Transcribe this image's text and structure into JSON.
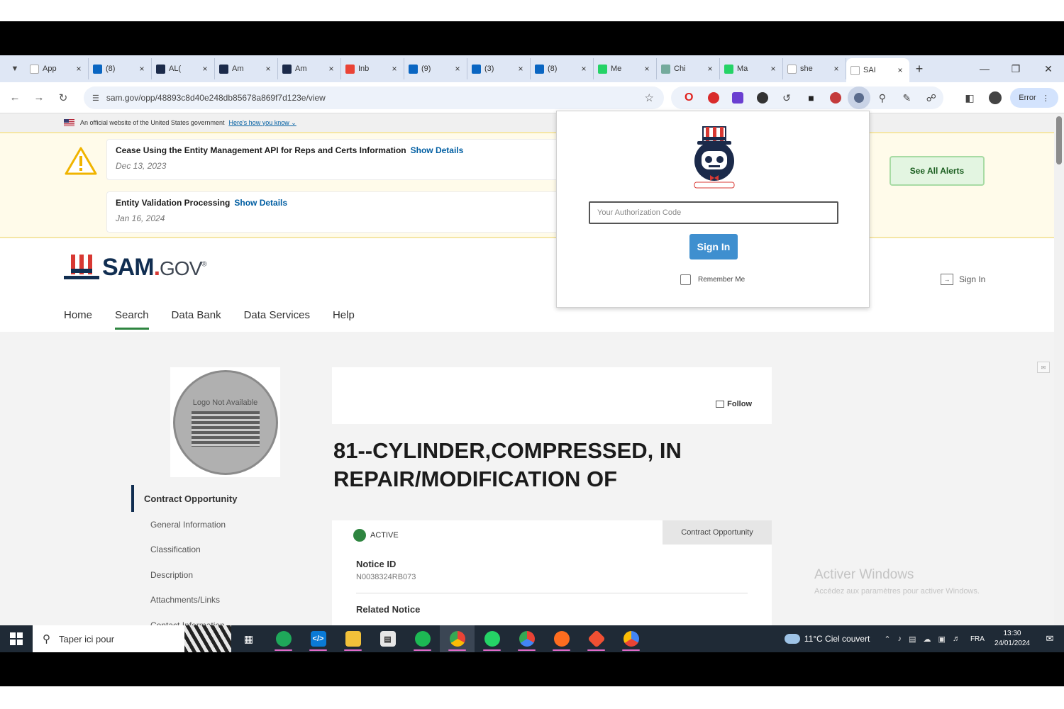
{
  "browser": {
    "tabs": [
      {
        "label": "App",
        "favicon": "doc",
        "color": "#ffffff"
      },
      {
        "label": "(8)",
        "favicon": "in",
        "color": "#0a66c2"
      },
      {
        "label": "AL(",
        "favicon": "dot",
        "color": "#1b2a4a"
      },
      {
        "label": "Am",
        "favicon": "dot",
        "color": "#1b2a4a"
      },
      {
        "label": "Am",
        "favicon": "dot",
        "color": "#1b2a4a"
      },
      {
        "label": "Inb",
        "favicon": "M",
        "color": "#ea4335"
      },
      {
        "label": "(9)",
        "favicon": "in",
        "color": "#0a66c2"
      },
      {
        "label": "(3)",
        "favicon": "in",
        "color": "#0a66c2"
      },
      {
        "label": "(8)",
        "favicon": "in",
        "color": "#0a66c2"
      },
      {
        "label": "Me",
        "favicon": "wa",
        "color": "#25d366"
      },
      {
        "label": "Chi",
        "favicon": "g",
        "color": "#74aa9c"
      },
      {
        "label": "Ma",
        "favicon": "wa",
        "color": "#25d366"
      },
      {
        "label": "she",
        "favicon": "G",
        "color": "#ffffff"
      },
      {
        "label": "SAI",
        "favicon": "sam",
        "color": "#ffffff"
      }
    ],
    "new_tab": "+",
    "url": "sam.gov/opp/48893c8d40e248db85678a869f7d123e/view",
    "profile_label": "Error",
    "tab_close": "×"
  },
  "gov_banner": {
    "text": "An official website of the United States government",
    "link": "Here's how you know"
  },
  "alerts": {
    "items": [
      {
        "title": "Cease Using the Entity Management API for Reps and Certs Information",
        "link": "Show Details",
        "date": "Dec 13, 2023"
      },
      {
        "title": "Entity Validation Processing",
        "link": "Show Details",
        "date": "Jan 16, 2024"
      }
    ],
    "see_all": "See All Alerts"
  },
  "header": {
    "logo_sam": "SAM",
    "logo_dot": ".",
    "logo_gov": "GOV",
    "logo_mark": "®",
    "sign_in": "Sign In",
    "nav": [
      "Home",
      "Search",
      "Data Bank",
      "Data Services",
      "Help"
    ]
  },
  "sidebar": {
    "seal_text": "Logo Not Available",
    "current": "Contract Opportunity",
    "items": [
      "General Information",
      "Classification",
      "Description",
      "Attachments/Links",
      "Contact Information"
    ]
  },
  "opportunity": {
    "follow": "Follow",
    "title": "81--CYLINDER,COMPRESSED, IN REPAIR/MODIFICATION OF",
    "status": "ACTIVE",
    "type": "Contract Opportunity",
    "notice_id_label": "Notice ID",
    "notice_id": "N0038324RB073",
    "related_label": "Related Notice"
  },
  "watermark": {
    "line1": "Activer Windows",
    "line2": "Accédez aux paramètres pour activer Windows."
  },
  "popup": {
    "placeholder": "Your Authorization Code",
    "sign_in": "Sign In",
    "remember": "Remember Me"
  },
  "taskbar": {
    "search": "Taper ici pour",
    "weather": "11°C  Ciel couvert",
    "lang": "FRA",
    "time": "13:30",
    "date": "24/01/2024"
  }
}
